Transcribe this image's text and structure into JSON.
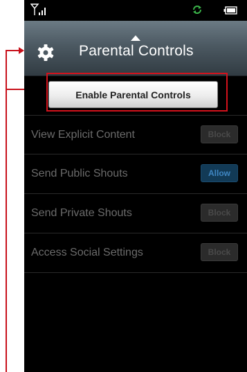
{
  "header": {
    "title": "Parental Controls"
  },
  "enable_button": {
    "label": "Enable Parental Controls"
  },
  "settings": [
    {
      "label": "View Explicit Content",
      "state": "Block"
    },
    {
      "label": "Send Public Shouts",
      "state": "Allow"
    },
    {
      "label": "Send Private Shouts",
      "state": "Block"
    },
    {
      "label": "Access Social Settings",
      "state": "Block"
    }
  ],
  "colors": {
    "annotation": "#c8101a",
    "allow_toggle": "#123a56",
    "block_toggle": "#2b2b2b"
  },
  "icons": {
    "signal": "signal-icon",
    "sync": "sync-icon",
    "battery": "battery-icon",
    "gear": "gear-icon",
    "caret": "caret-up-icon"
  }
}
